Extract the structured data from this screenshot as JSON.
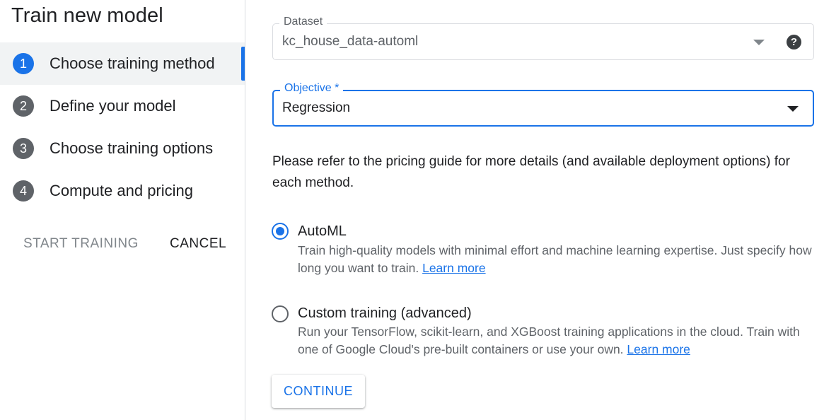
{
  "sidebar": {
    "title": "Train new model",
    "steps": [
      {
        "number": "1",
        "label": "Choose training method",
        "active": true
      },
      {
        "number": "2",
        "label": "Define your model",
        "active": false
      },
      {
        "number": "3",
        "label": "Choose training options",
        "active": false
      },
      {
        "number": "4",
        "label": "Compute and pricing",
        "active": false
      }
    ],
    "start_training_label": "START TRAINING",
    "cancel_label": "CANCEL"
  },
  "main": {
    "dataset": {
      "label": "Dataset",
      "value": "kc_house_data-automl",
      "help_icon": "?"
    },
    "objective": {
      "label": "Objective *",
      "value": "Regression"
    },
    "info_text": "Please refer to the pricing guide for more details (and available deployment options) for each method.",
    "options": [
      {
        "title": "AutoML",
        "selected": true,
        "description": "Train high-quality models with minimal effort and machine learning expertise. Just specify how long you want to train.",
        "link_text": "Learn more"
      },
      {
        "title": "Custom training (advanced)",
        "selected": false,
        "description": "Run your TensorFlow, scikit-learn, and XGBoost training applications in the cloud. Train with one of Google Cloud's pre-built containers or use your own.",
        "link_text": "Learn more"
      }
    ],
    "continue_label": "CONTINUE"
  },
  "colors": {
    "accent": "#1a73e8",
    "step_inactive": "#5f6368",
    "text_primary": "#202124",
    "text_secondary": "#5f6368",
    "active_step_bg": "#f1f3f4"
  },
  "icons": {
    "dataset_dropdown": "chevron-down-icon",
    "objective_dropdown": "chevron-down-icon",
    "help": "help-icon"
  }
}
